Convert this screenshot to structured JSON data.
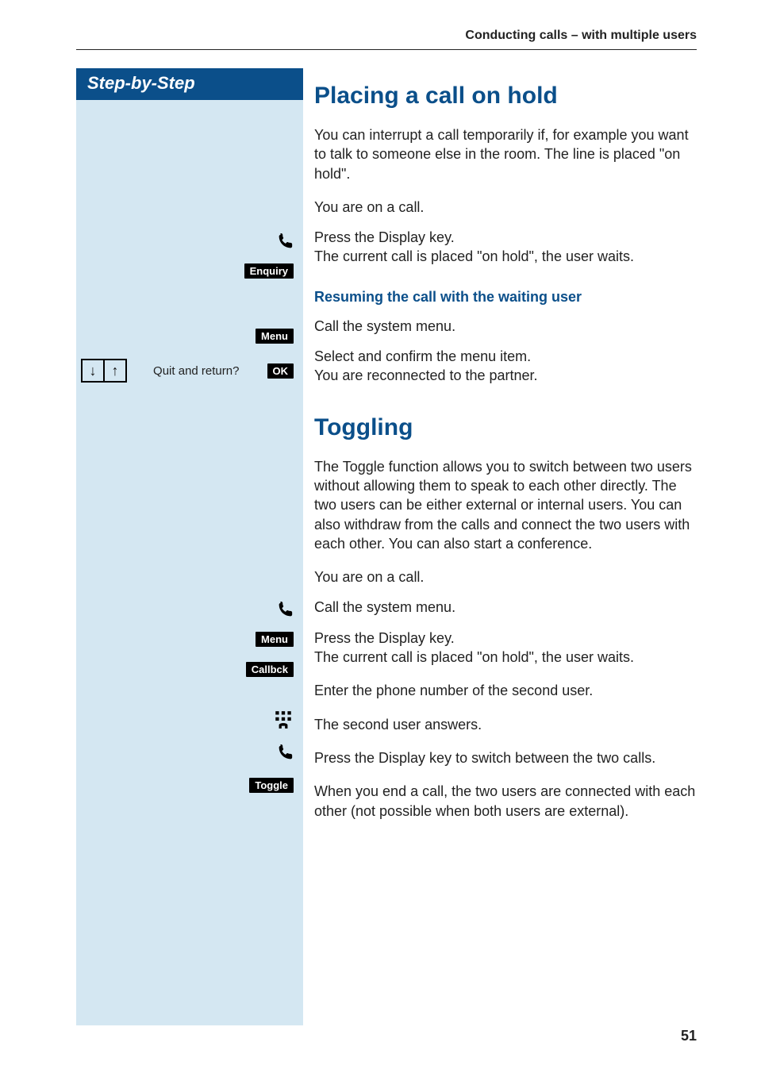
{
  "running_head": "Conducting calls – with multiple users",
  "sidebar": {
    "header": "Step-by-Step",
    "nav_label": "Quit and return?"
  },
  "keys": {
    "enquiry": "Enquiry",
    "menu": "Menu",
    "ok": "OK",
    "callbck": "Callbck",
    "toggle": "Toggle"
  },
  "section1": {
    "title": "Placing a call on hold",
    "intro": "You can interrupt a call temporarily if, for example  you want to talk to someone else in the room. The line is placed \"on hold\".",
    "s1": "You are on a call.",
    "s2a": "Press the Display key.",
    "s2b": "The current call is placed \"on hold\", the user waits.",
    "subhead": "Resuming the call with the waiting user",
    "s3": "Call the system menu.",
    "s4a": "Select and confirm the menu item.",
    "s4b": "You are reconnected to the partner."
  },
  "section2": {
    "title": "Toggling",
    "intro": "The Toggle function allows you to switch between two users without allowing them to speak to each other directly. The two users can be either external or internal users. You can also withdraw from the calls and connect the two users with each other. You can also start a conference.",
    "s1": "You are on a call.",
    "s2": "Call the system menu.",
    "s3a": "Press the Display key.",
    "s3b": "The current call is placed \"on hold\", the user waits.",
    "s4": "Enter the phone number of the second user.",
    "s5": "The second user answers.",
    "s6": "Press the Display key to switch between the two calls.",
    "s7": "When you end a call, the two users are connected with each other (not possible when both users are external)."
  },
  "page_number": "51"
}
